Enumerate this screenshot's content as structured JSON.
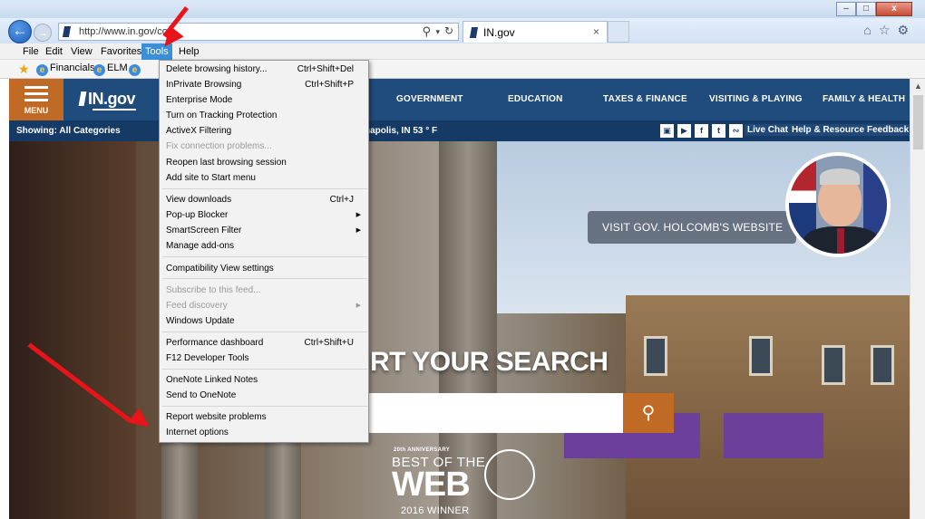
{
  "browser": {
    "url": "http://www.in.gov/cor",
    "tab_title": "IN.gov",
    "window_buttons": {
      "minimize": "–",
      "maximize": "□",
      "close": "x"
    }
  },
  "menubar": [
    "File",
    "Edit",
    "View",
    "Favorites",
    "Tools",
    "Help"
  ],
  "favorites": [
    "Financials",
    "ELM"
  ],
  "tools_menu": {
    "items": [
      {
        "label": "Delete browsing history...",
        "shortcut": "Ctrl+Shift+Del"
      },
      {
        "label": "InPrivate Browsing",
        "shortcut": "Ctrl+Shift+P"
      },
      {
        "label": "Enterprise Mode"
      },
      {
        "label": "Turn on Tracking Protection"
      },
      {
        "label": "ActiveX Filtering"
      },
      {
        "label": "Fix connection problems..."
      },
      {
        "label": "Reopen last browsing session"
      },
      {
        "label": "Add site to Start menu"
      },
      {
        "label": "View downloads",
        "shortcut": "Ctrl+J"
      },
      {
        "label": "Pop-up Blocker"
      },
      {
        "label": "SmartScreen Filter"
      },
      {
        "label": "Manage add-ons"
      },
      {
        "label": "Compatibility View settings"
      },
      {
        "label": "Subscribe to this feed..."
      },
      {
        "label": "Feed discovery"
      },
      {
        "label": "Windows Update"
      },
      {
        "label": "Performance dashboard",
        "shortcut": "Ctrl+Shift+U"
      },
      {
        "label": "F12 Developer Tools"
      },
      {
        "label": "OneNote Linked Notes"
      },
      {
        "label": "Send to OneNote"
      },
      {
        "label": "Report website problems"
      },
      {
        "label": "Internet options"
      }
    ]
  },
  "site": {
    "menu_label": "MENU",
    "logo": "IN.gov",
    "nav": [
      "GOVERNMENT",
      "EDUCATION",
      "TAXES & FINANCE",
      "VISITING & PLAYING",
      "FAMILY & HEALTH"
    ],
    "showing": "Showing: All Categories",
    "weather": "napolis, IN 53 ° F",
    "social": [
      "instagram",
      "youtube",
      "facebook",
      "twitter",
      "rss"
    ],
    "links": [
      "Live Chat",
      "Help & Resources",
      "Feedback"
    ],
    "gov_callout": "VISIT GOV. HOLCOMB'S WEBSITE",
    "search_heading": "RT YOUR SEARCH",
    "search_icon": "magnifier-icon",
    "badge": {
      "anniversary": "20th ANNIVERSARY",
      "best": "BEST OF THE",
      "web": "WEB",
      "winner": "2016 WINNER"
    }
  },
  "colors": {
    "header_blue": "#1f4b7d",
    "accent_orange": "#c06a25",
    "menu_highlight": "#3a8fd8",
    "annotation_red": "#e8141a"
  }
}
